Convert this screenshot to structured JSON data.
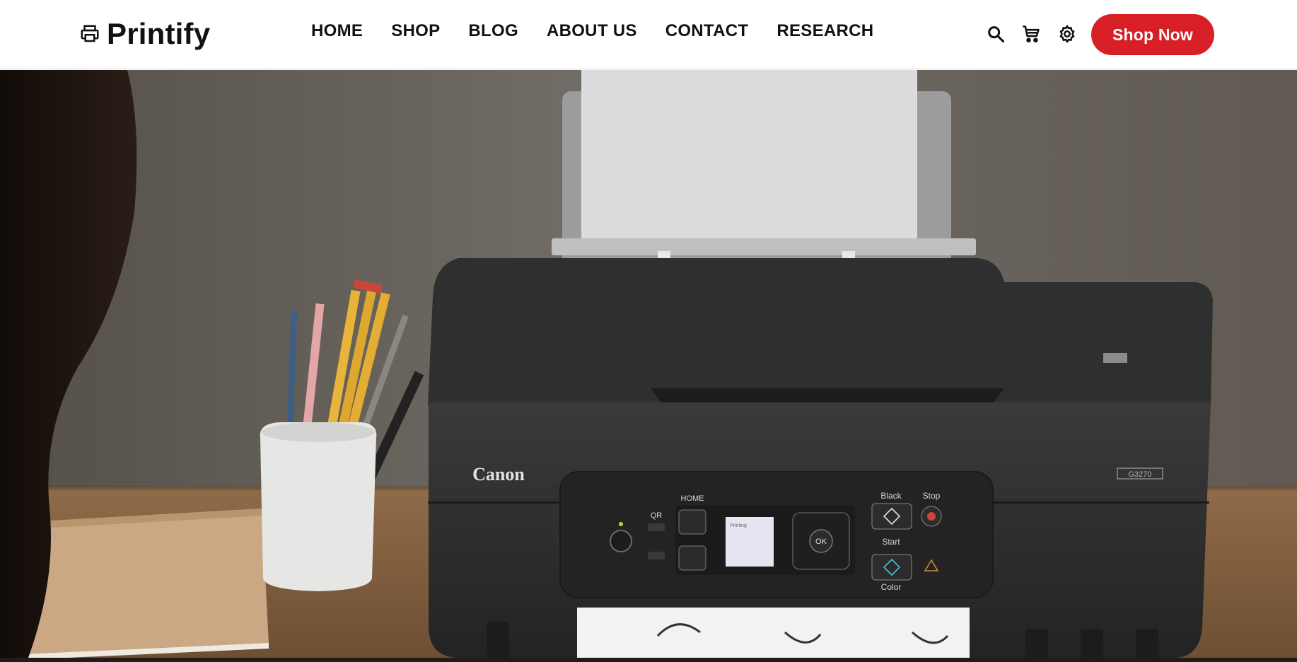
{
  "brand": {
    "name": "Printify",
    "icon": "printer-icon"
  },
  "nav": {
    "items": [
      {
        "label": "HOME"
      },
      {
        "label": "SHOP"
      },
      {
        "label": "BLOG"
      },
      {
        "label": "ABOUT US"
      },
      {
        "label": "CONTACT"
      },
      {
        "label": "RESEARCH"
      }
    ]
  },
  "actions": {
    "search_icon": "search-icon",
    "cart_icon": "cart-icon",
    "settings_icon": "gear-icon",
    "shop_now_label": "Shop Now"
  },
  "hero": {
    "printer_brand": "Canon",
    "model": "G3270",
    "panel": {
      "home": "HOME",
      "qr": "QR",
      "black": "Black",
      "stop": "Stop",
      "start": "Start",
      "color": "Color",
      "ok": "OK",
      "screen_text": "Printing"
    }
  },
  "colors": {
    "accent": "#d91f26",
    "text": "#111111",
    "wall": "#6e6a64",
    "printer": "#2b2b2c",
    "desk": "#8a6746"
  }
}
